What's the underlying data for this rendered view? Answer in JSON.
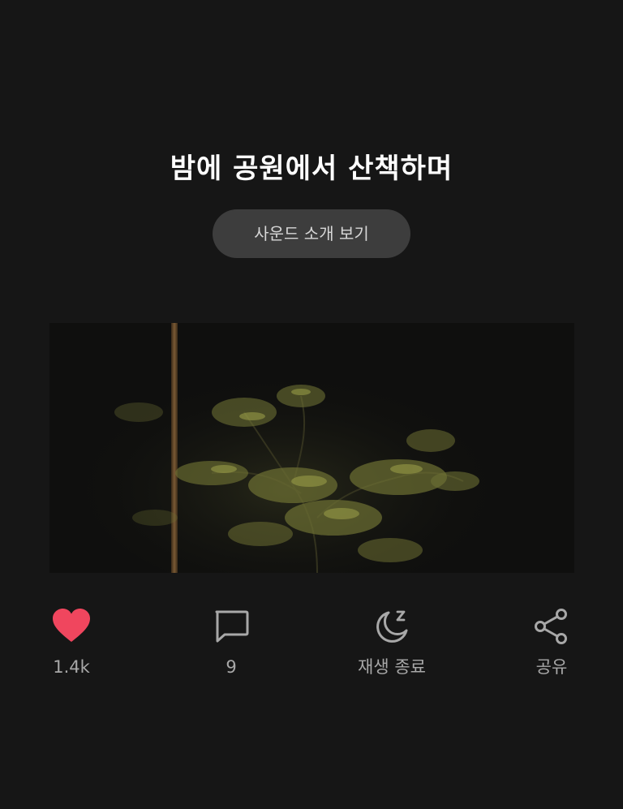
{
  "sound": {
    "title": "밤에 공원에서 산책하며",
    "intro_button_label": "사운드 소개 보기"
  },
  "actions": {
    "like": {
      "label": "1.4k",
      "icon": "heart-icon",
      "active": true,
      "color": "#f0465e"
    },
    "comment": {
      "label": "9",
      "icon": "comment-icon"
    },
    "sleep_timer": {
      "label": "재생 종료",
      "icon": "moon-zz-icon"
    },
    "share": {
      "label": "공유",
      "icon": "share-icon"
    }
  },
  "colors": {
    "background": "#161616",
    "button": "#3d3d3d",
    "muted_text": "#a8a8a8",
    "like": "#f0465e"
  }
}
